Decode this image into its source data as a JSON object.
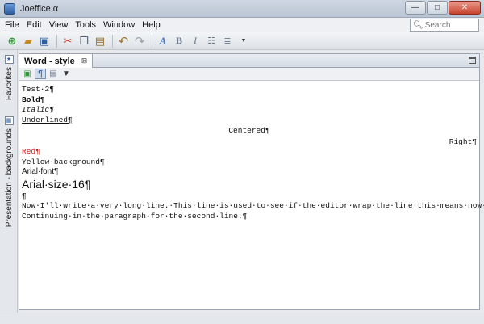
{
  "window": {
    "title": "Joeffice α"
  },
  "menu": {
    "items": [
      "File",
      "Edit",
      "View",
      "Tools",
      "Window",
      "Help"
    ],
    "search_placeholder": "Search"
  },
  "side_tabs": [
    "Favorites",
    "Presentation - backgrounds"
  ],
  "editor_tab": {
    "label": "Word - style",
    "close": "⊠"
  },
  "document": {
    "lines": [
      "Test·2¶",
      "Bold¶",
      "Italic¶",
      "Underlined¶",
      "Centered¶",
      "Right¶",
      "Red¶",
      "Yellow·background¶",
      "Arial·font¶",
      "Arial·size·16¶",
      "¶",
      "Now·I'll·write·a·very·long·line.·This·line·is·used·to·see·if·the·editor·wrap·the·line·this·means·now·!·",
      "Continuing·in·the·paragraph·for·the·second·line.¶"
    ],
    "red_color": "#d42020"
  }
}
